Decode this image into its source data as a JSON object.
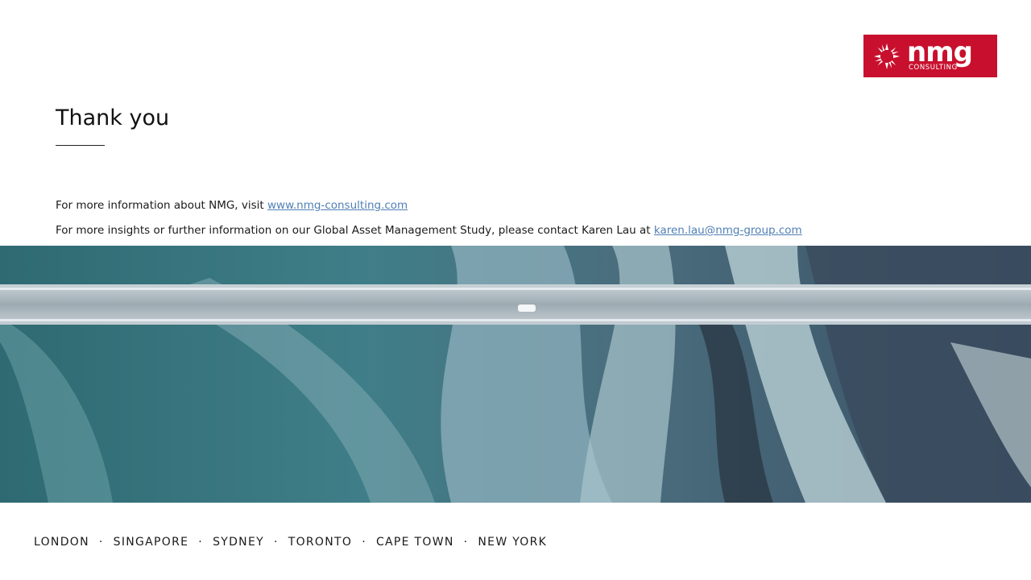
{
  "logo": {
    "word": "nmg",
    "sub": "CONSULTING",
    "brand_color": "#c8102e",
    "icon": "starburst-icon"
  },
  "title": "Thank you",
  "info": {
    "line1_text": "For more information about NMG, visit ",
    "line1_link": "www.nmg-consulting.com",
    "line2_text": "For more insights or further information  on our Global Asset Management Study, please contact Karen Lau at ",
    "line2_link": "karen.lau@nmg-group.com",
    "link_color": "#4f7fb5"
  },
  "photo": {
    "description_icon": "aerial-bridge-river-image"
  },
  "cities": [
    "LONDON",
    "SINGAPORE",
    "SYDNEY",
    "TORONTO",
    "CAPE TOWN",
    "NEW YORK"
  ],
  "separator": "·"
}
